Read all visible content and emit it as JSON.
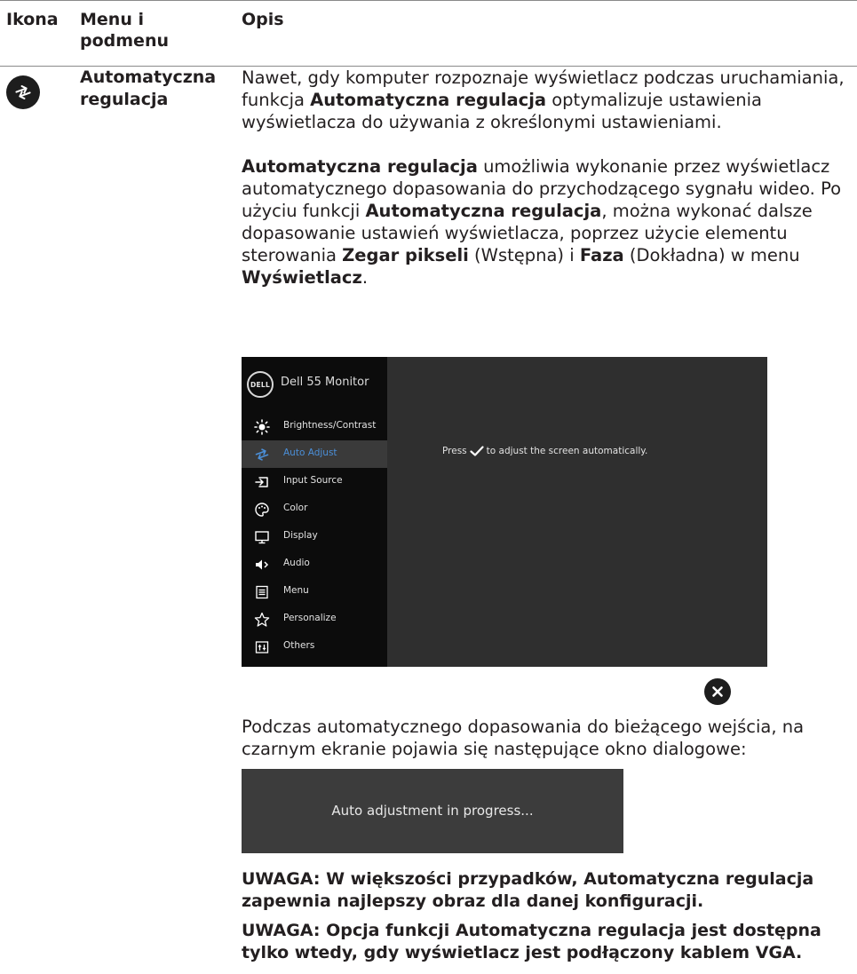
{
  "table_header": {
    "icon": "Ikona",
    "menu": "Menu i podmenu",
    "description": "Opis"
  },
  "row": {
    "icon": "auto-adjust-icon",
    "menu_label": "Automatyczna regulacja",
    "p1": {
      "a": "Nawet, gdy komputer rozpoznaje wyświetlacz podczas uruchamiania, funkcja ",
      "b": "Automatyczna regulacja",
      "c": " optymalizuje ustawienia wyświetlacza do używania z określonymi ustawieniami."
    },
    "p2": {
      "a": "Automatyczna regulacja",
      "b": " umożliwia wykonanie przez wyświetlacz automatycznego dopasowania do przychodzącego sygnału wideo. Po użyciu funkcji ",
      "c": "Automatyczna regulacja",
      "d": ", można wykonać dalsze dopasowanie ustawień wyświetlacza, poprzez użycie elementu sterowania ",
      "e": "Zegar pikseli",
      "f": " (Wstępna) i ",
      "g": "Faza",
      "h": " (Dokładna) w menu ",
      "i": "Wyświetlacz",
      "j": "."
    },
    "p3": "Podczas automatycznego dopasowania do bieżącego wejścia, na czarnym ekranie pojawia się następujące okno dialogowe:",
    "note1": "UWAGA: W większości przypadków, Automatyczna regulacja zapewnia najlepszy obraz dla danej konfiguracji.",
    "note2": "UWAGA: Opcja funkcji Automatyczna regulacja jest dostępna tylko wtedy, gdy wyświetlacz jest podłączony kablem VGA."
  },
  "osd": {
    "logo": "DELL",
    "title": "Dell 55 Monitor",
    "items": [
      {
        "label": "Brightness/Contrast",
        "icon": "brightness-icon"
      },
      {
        "label": "Auto Adjust",
        "icon": "auto-adjust-icon",
        "selected": true
      },
      {
        "label": "Input Source",
        "icon": "input-source-icon"
      },
      {
        "label": "Color",
        "icon": "color-palette-icon"
      },
      {
        "label": "Display",
        "icon": "display-icon"
      },
      {
        "label": "Audio",
        "icon": "speaker-icon"
      },
      {
        "label": "Menu",
        "icon": "menu-icon"
      },
      {
        "label": "Personalize",
        "icon": "star-icon"
      },
      {
        "label": "Others",
        "icon": "others-icon"
      }
    ],
    "message_before": "Press",
    "message_after": "to adjust the screen automatically.",
    "accent_color": "#4b8fd8",
    "close_icon": "close-icon"
  },
  "progress_dialog": {
    "text": "Auto adjustment in progress..."
  }
}
